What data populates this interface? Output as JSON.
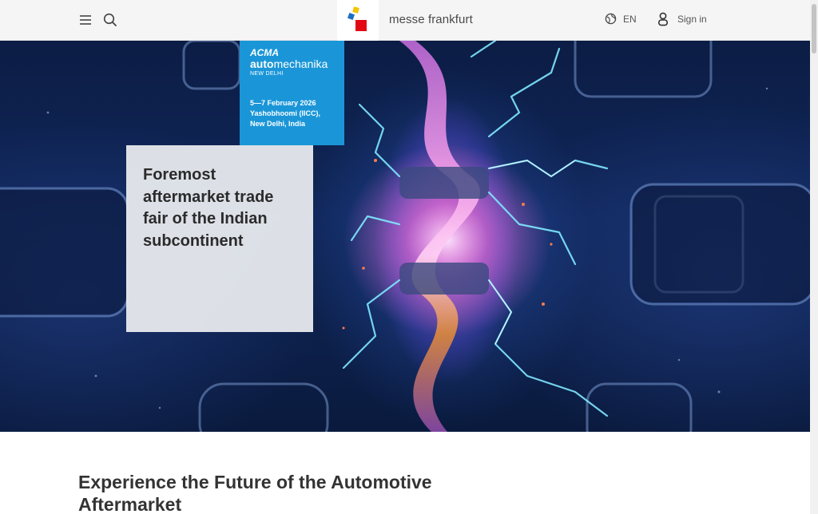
{
  "header": {
    "brand": "messe frankfurt",
    "language": "EN",
    "signin_label": "Sign in",
    "icons": [
      "menu-icon",
      "search-icon",
      "globe-icon",
      "user-icon"
    ],
    "logo_colors": [
      "#1a6fc2",
      "#f4c400",
      "#e30613"
    ]
  },
  "hero": {
    "badge": {
      "acma": "ACMA",
      "auto_bold": "auto",
      "auto_rest": "mechanika",
      "city": "NEW DELHI",
      "dates": "5—7 February 2026",
      "venue": "Yashobhoomi (IICC), New Delhi, India",
      "color": "#1a96d8"
    },
    "tagline": "Foremost aftermarket trade fair of the Indian subcontinent"
  },
  "main": {
    "section_title": "Experience the Future of the Automotive Aftermarket"
  }
}
